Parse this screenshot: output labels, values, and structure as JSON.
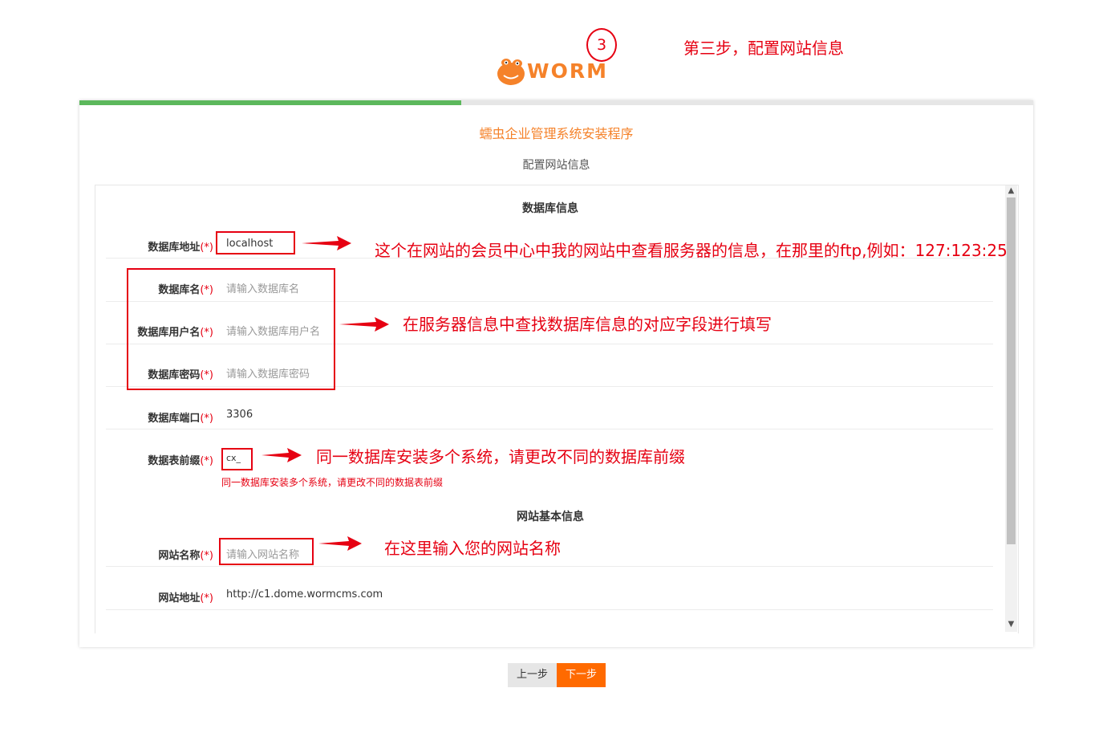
{
  "header": {
    "step_number": "3",
    "logo_text": "WORM",
    "step_note": "第三步，配置网站信息"
  },
  "installer": {
    "title": "蠕虫企业管理系统安装程序",
    "subtitle": "配置网站信息",
    "progress": 0.4
  },
  "db_section": {
    "title": "数据库信息",
    "fields": [
      {
        "label": "数据库地址",
        "required": "(*)",
        "value": "localhost",
        "placeholder": ""
      },
      {
        "label": "数据库名",
        "required": "(*)",
        "value": "",
        "placeholder": "请输入数据库名"
      },
      {
        "label": "数据库用户名",
        "required": "(*)",
        "value": "",
        "placeholder": "请输入数据库用户名"
      },
      {
        "label": "数据库密码",
        "required": "(*)",
        "value": "",
        "placeholder": "请输入数据库密码"
      },
      {
        "label": "数据库端口",
        "required": "(*)",
        "value": "3306",
        "placeholder": ""
      },
      {
        "label": "数据表前缀",
        "required": "(*)",
        "value": "cx_",
        "placeholder": ""
      }
    ],
    "prefix_hint": "同一数据库安装多个系统，请更改不同的数据表前缀"
  },
  "site_section": {
    "title": "网站基本信息",
    "fields": [
      {
        "label": "网站名称",
        "required": "(*)",
        "value": "",
        "placeholder": "请输入网站名称"
      },
      {
        "label": "网站地址",
        "required": "(*)",
        "value": "http://c1.dome.wormcms.com",
        "placeholder": ""
      }
    ]
  },
  "annotations": {
    "host_note": "这个在网站的会员中心中我的网站中查看服务器的信息，在那里的ftp,例如：127:123:25",
    "db_fields_note": "在服务器信息中查找数据库信息的对应字段进行填写",
    "prefix_note": "同一数据库安装多个系统，请更改不同的数据库前缀",
    "sitename_note": "在这里输入您的网站名称"
  },
  "buttons": {
    "prev": "上一步",
    "next": "下一步"
  },
  "colors": {
    "accent": "#f5822a",
    "annotation_red": "#e60012",
    "progress_green": "#5cb85c",
    "next_button": "#ff6a00"
  }
}
